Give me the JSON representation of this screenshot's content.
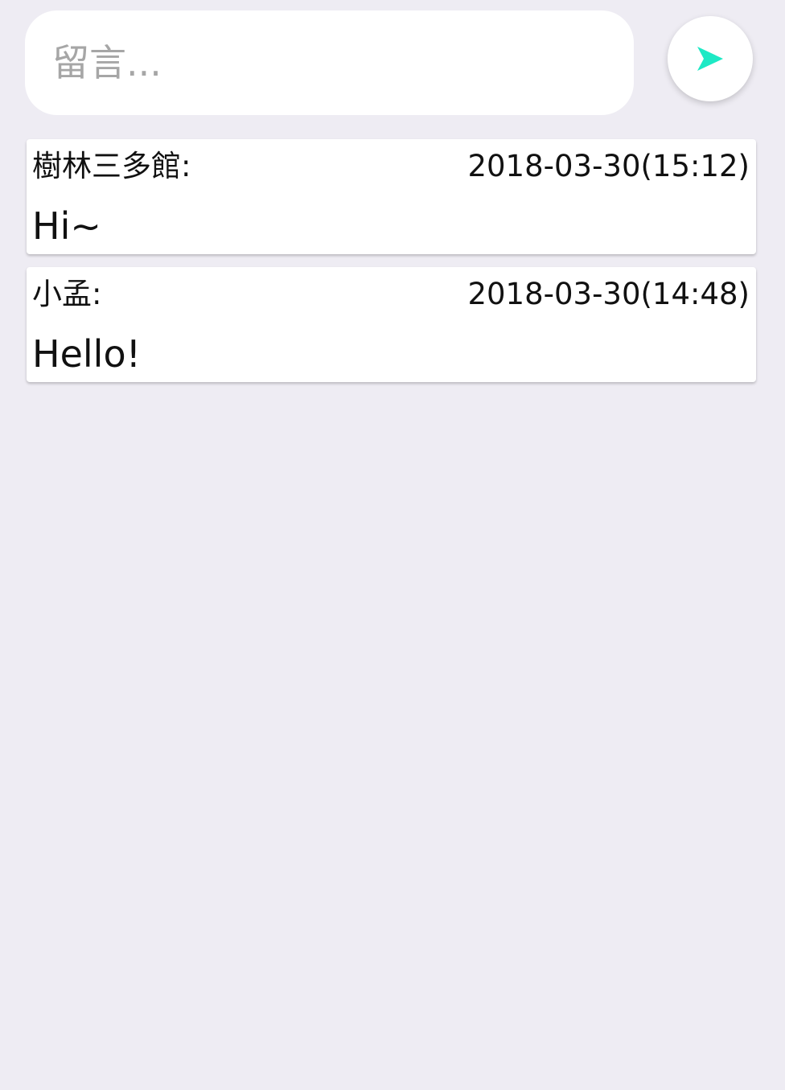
{
  "composer": {
    "placeholder": "留言...",
    "value": ""
  },
  "send_button": {
    "icon": "send-arrow-icon",
    "icon_color": "#1de9c5"
  },
  "messages": [
    {
      "author": "樹林三多館:",
      "time": "2018-03-30(15:12)",
      "text": "Hi~"
    },
    {
      "author": "小孟:",
      "time": "2018-03-30(14:48)",
      "text": "Hello!"
    }
  ],
  "colors": {
    "background": "#eeecf3",
    "card": "#ffffff",
    "accent": "#1de9c5"
  }
}
